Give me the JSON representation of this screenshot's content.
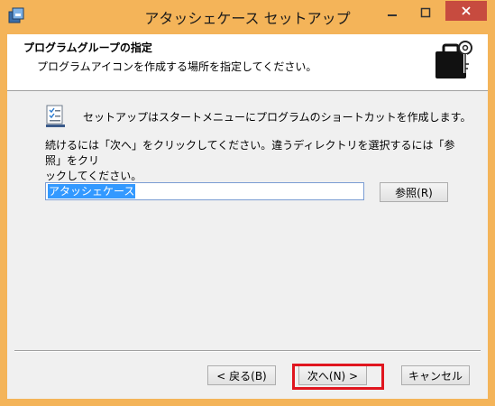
{
  "window": {
    "title": "アタッシェケース セットアップ",
    "colors": {
      "frame": "#f4b459",
      "close": "#c74b3f",
      "highlight": "#e0161f"
    },
    "icons": [
      "setup-app-icon",
      "minimize-icon",
      "maximize-icon",
      "close-icon"
    ]
  },
  "header": {
    "title": "プログラムグループの指定",
    "subtitle": "プログラムアイコンを作成する場所を指定してください。",
    "icon": "briefcase-key-icon"
  },
  "body": {
    "info": "セットアップはスタートメニューにプログラムのショートカットを作成します。",
    "instruction_line1": "続けるには「次へ」をクリックしてください。違うディレクトリを選択するには「参照」をクリ",
    "instruction_line2": "ックしてください。",
    "folder_value": "アタッシェケース",
    "browse_label": "参照(R)"
  },
  "footer": {
    "back_label": "< 戻る(B)",
    "next_label": "次へ(N) >",
    "cancel_label": "キャンセル"
  }
}
